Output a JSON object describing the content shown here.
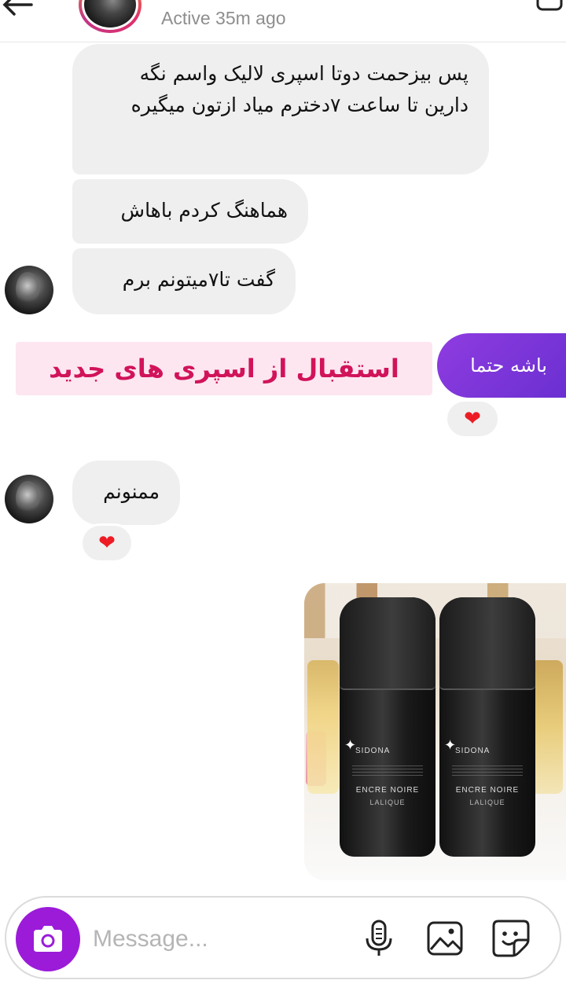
{
  "header": {
    "status": "Active 35m ago",
    "back_icon": "arrow-left-icon",
    "right_icon": "video-call-icon"
  },
  "messages": {
    "m1": "پس بیزحمت دوتا اسپری لالیک واسم نگه دارین تا ساعت ۷دخترم میاد ازتون میگیره",
    "m2": "هماهنگ کردم باهاش",
    "m3": "گفت تا۷میتونم برم",
    "sent1": "باشه حتما",
    "m4": "ممنونم"
  },
  "overlay_title": "استقبال از اسپری های جدید",
  "reactions": {
    "r1": "❤",
    "r2": "❤"
  },
  "photo": {
    "brand": "SIDONA",
    "product_name": "ENCRE NOIRE",
    "product_sub": "LALIQUE"
  },
  "composer": {
    "placeholder": "Message..."
  },
  "colors": {
    "sent_bubble": "#7b35d9",
    "camera_button": "#9b1bd9",
    "overlay_text": "#d1135a",
    "overlay_bg": "#fde6f0",
    "received_bubble": "#efefef"
  }
}
